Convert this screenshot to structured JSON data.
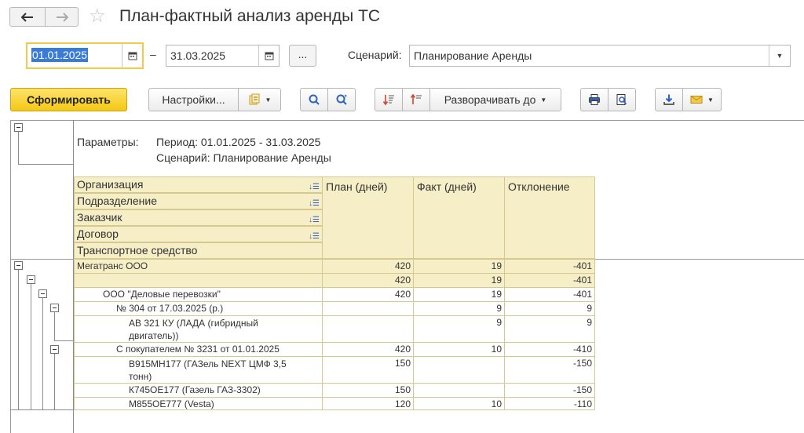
{
  "window": {
    "title": "План-фактный анализ аренды ТС"
  },
  "nav": {
    "back_icon": "arrow-left-icon",
    "forward_icon": "arrow-right-icon",
    "favorite_icon": "star-icon"
  },
  "period": {
    "from": "01.01.2025",
    "separator": "–",
    "to": "31.03.2025",
    "more_label": "..."
  },
  "scenario": {
    "label": "Сценарий:",
    "value": "Планирование Аренды"
  },
  "toolbar": {
    "generate_label": "Сформировать",
    "settings_label": "Настройки...",
    "expand_label": "Разворачивать до",
    "accent": "#f5c814"
  },
  "report": {
    "params_label": "Параметры:",
    "params_period": "Период: 01.01.2025 - 31.03.2025",
    "params_scenario": "Сценарий: Планирование Аренды",
    "groupings": [
      "Организация",
      "Подразделение",
      "Заказчик",
      "Договор",
      "Транспортное средство"
    ],
    "columns": [
      "План (дней)",
      "Факт (дней)",
      "Отклонение"
    ],
    "header_color": "#f6eec6",
    "rows": [
      {
        "name": "Мегатранс ООО",
        "plan": "420",
        "fact": "19",
        "dev": "-401"
      },
      {
        "name": "",
        "plan": "420",
        "fact": "19",
        "dev": "-401"
      },
      {
        "name": "ООО \"Деловые перевозки\"",
        "plan": "420",
        "fact": "19",
        "dev": "-401"
      },
      {
        "name": "№ 304 от 17.03.2025 (р.)",
        "plan": "",
        "fact": "9",
        "dev": "9"
      },
      {
        "name_l1": "АВ 321 КУ (ЛАДА (гибридный",
        "name_l2": "двигатель))",
        "plan": "",
        "fact": "9",
        "dev": "9"
      },
      {
        "name": "С покупателем № 3231 от 01.01.2025",
        "plan": "420",
        "fact": "10",
        "dev": "-410"
      },
      {
        "name_l1": "В915МН177 (ГАЗель NEXT ЦМФ 3,5",
        "name_l2": "тонн)",
        "plan": "150",
        "fact": "",
        "dev": "-150"
      },
      {
        "name": "К745ОЕ177 (Газель ГАЗ-3302)",
        "plan": "150",
        "fact": "",
        "dev": "-150"
      },
      {
        "name": "М855ОЕ777 (Vesta)",
        "plan": "120",
        "fact": "10",
        "dev": "-110"
      }
    ]
  }
}
